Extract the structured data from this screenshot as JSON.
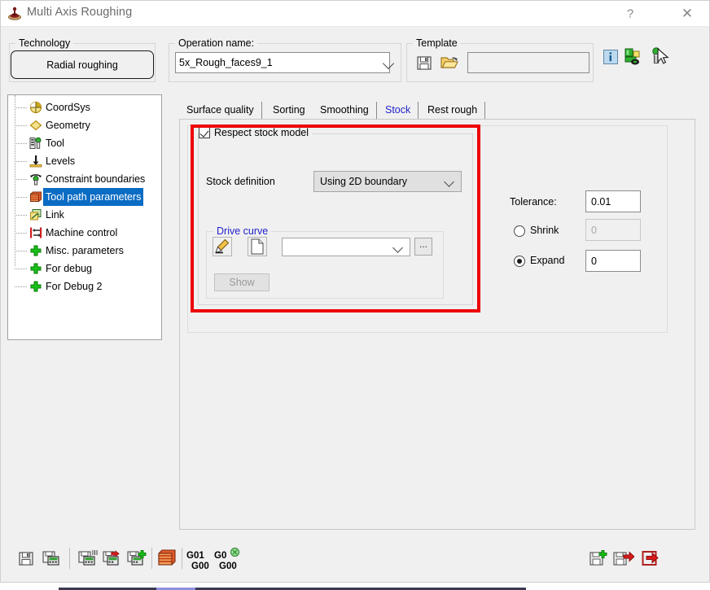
{
  "window": {
    "title": "Multi Axis Roughing",
    "icon": "roughing-tool-icon",
    "help_label": "?",
    "close_label": "✕"
  },
  "technology": {
    "legend": "Technology",
    "button_label": "Radial roughing"
  },
  "operation": {
    "legend": "Operation name:",
    "value": "5x_Rough_faces9_1"
  },
  "template": {
    "legend": "Template",
    "value": "",
    "save_icon": "floppy-save-icon",
    "open_icon": "folder-open-icon"
  },
  "header_tools": [
    {
      "name": "info-icon",
      "label": "i"
    },
    {
      "name": "tool-settings-icon",
      "label": ""
    },
    {
      "name": "tool-pick-icon",
      "label": ""
    }
  ],
  "tree": {
    "items": [
      {
        "label": "CoordSys",
        "icon": "coordsys-icon",
        "selected": false
      },
      {
        "label": "Geometry",
        "icon": "geometry-diamond-icon",
        "selected": false
      },
      {
        "label": "Tool",
        "icon": "tool-icon",
        "selected": false
      },
      {
        "label": "Levels",
        "icon": "levels-arrow-icon",
        "selected": false
      },
      {
        "label": "Constraint boundaries",
        "icon": "constraint-boundaries-icon",
        "selected": false
      },
      {
        "label": "Tool path parameters",
        "icon": "tool-path-parameters-icon",
        "selected": true
      },
      {
        "label": "Link",
        "icon": "link-icon",
        "selected": false
      },
      {
        "label": "Machine control",
        "icon": "machine-control-icon",
        "selected": false
      },
      {
        "label": "Misc. parameters",
        "icon": "plus-green-icon",
        "selected": false
      },
      {
        "label": "For debug",
        "icon": "plus-green-icon",
        "selected": false
      },
      {
        "label": "For Debug 2",
        "icon": "plus-green-icon",
        "selected": false
      }
    ]
  },
  "tabs": [
    {
      "label": "Surface quality",
      "active": false
    },
    {
      "label": "Sorting",
      "active": false
    },
    {
      "label": "Smoothing",
      "active": false
    },
    {
      "label": "Stock",
      "active": true
    },
    {
      "label": "Rest rough",
      "active": false
    }
  ],
  "stock_panel": {
    "respect_stock_model": {
      "label": "Respect stock model",
      "checked": true
    },
    "stock_definition": {
      "label": "Stock definition",
      "value": "Using 2D boundary",
      "options": [
        "Using 2D boundary"
      ]
    },
    "drive_curve": {
      "legend": "Drive curve",
      "edit_icon": "pencil-edit-icon",
      "new_icon": "new-page-icon",
      "combo_value": "",
      "browse_label": "...",
      "show_label": "Show"
    },
    "tolerance": {
      "label": "Tolerance:",
      "value": "0.01"
    },
    "shrink": {
      "label": "Shrink",
      "value": "0",
      "selected": false,
      "enabled": false
    },
    "expand": {
      "label": "Expand",
      "value": "0",
      "selected": true,
      "enabled": true
    }
  },
  "bottom_toolbar": {
    "left_items": [
      {
        "name": "save-icon",
        "label": ""
      },
      {
        "name": "save-calculate-icon",
        "label": ""
      },
      {
        "name": "save-calculate-list-icon",
        "label": ""
      },
      {
        "name": "calculate-simulate-icon",
        "label": ""
      },
      {
        "name": "calculate-add-icon",
        "label": ""
      },
      {
        "name": "stock-model-icon",
        "label": ""
      }
    ],
    "gcode_items": [
      {
        "name": "gcode-g01-g00",
        "line1": "G01",
        "line2": "G00"
      },
      {
        "name": "gcode-g0-g00-marked",
        "line1": "G0",
        "line2": "G00"
      }
    ],
    "right_items": [
      {
        "name": "save-add-icon",
        "label": ""
      },
      {
        "name": "save-exit-icon",
        "label": ""
      },
      {
        "name": "exit-icon",
        "label": ""
      }
    ]
  },
  "colors": {
    "accent_blue": "#0a6cc4",
    "tab_active_text": "#2222cc",
    "highlight_red": "#ee0000",
    "dialog_bg": "#f0f0f0"
  }
}
